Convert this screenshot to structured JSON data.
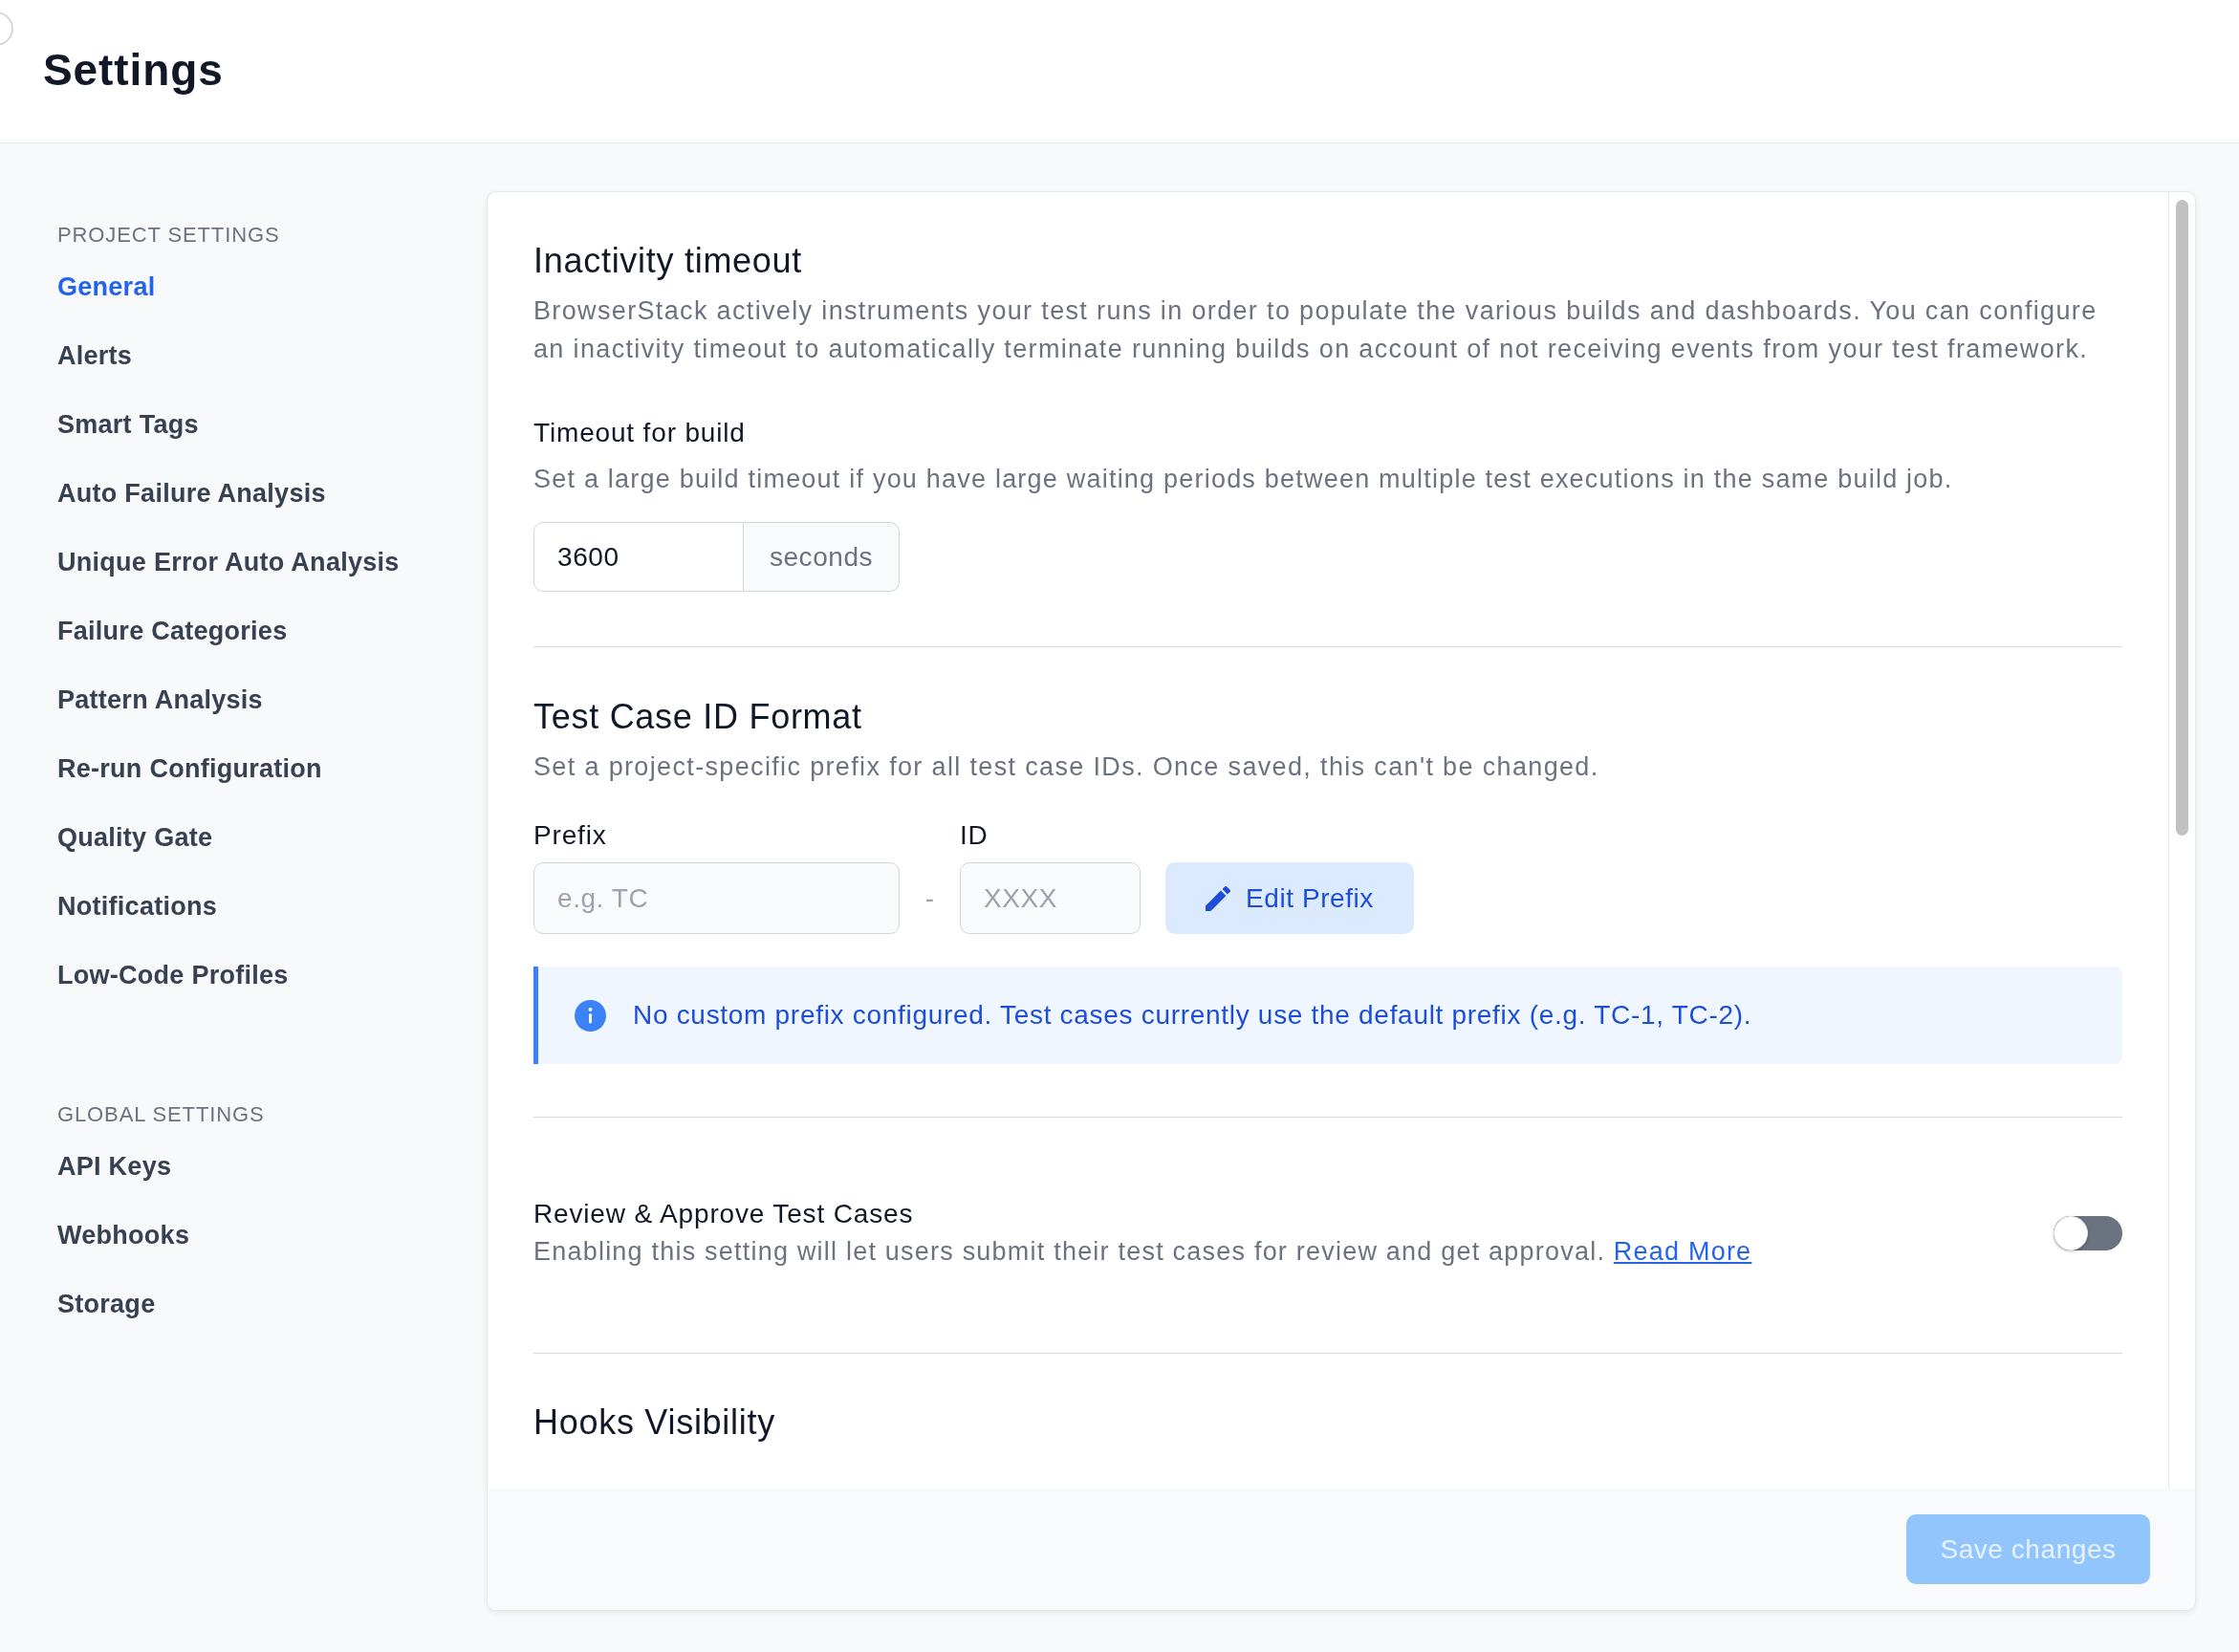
{
  "page": {
    "title": "Settings"
  },
  "sidebar": {
    "groups": [
      {
        "heading": "PROJECT SETTINGS",
        "items": [
          {
            "label": "General",
            "selected": true
          },
          {
            "label": "Alerts",
            "selected": false
          },
          {
            "label": "Smart Tags",
            "selected": false
          },
          {
            "label": "Auto Failure Analysis",
            "selected": false
          },
          {
            "label": "Unique Error Auto Analysis",
            "selected": false
          },
          {
            "label": "Failure Categories",
            "selected": false
          },
          {
            "label": "Pattern Analysis",
            "selected": false
          },
          {
            "label": "Re-run Configuration",
            "selected": false
          },
          {
            "label": "Quality Gate",
            "selected": false
          },
          {
            "label": "Notifications",
            "selected": false
          },
          {
            "label": "Low-Code Profiles",
            "selected": false
          }
        ]
      },
      {
        "heading": "GLOBAL SETTINGS",
        "items": [
          {
            "label": "API Keys",
            "selected": false
          },
          {
            "label": "Webhooks",
            "selected": false
          },
          {
            "label": "Storage",
            "selected": false
          }
        ]
      }
    ]
  },
  "sections": [
    {
      "kind": "timeout",
      "title": "Inactivity timeout",
      "description": "BrowserStack actively instruments your test runs in order to populate the various builds and dashboards. You can configure an inactivity timeout to automatically terminate running builds on account of not receiving events from your test framework.",
      "field": {
        "label": "Timeout for build",
        "hint": "Set a large build timeout if you have large waiting periods between multiple test executions in the same build job.",
        "value": "3600",
        "unit": "seconds"
      }
    },
    {
      "kind": "id_format",
      "title": "Test Case ID Format",
      "description": "Set a project-specific prefix for all test case IDs. Once saved, this can't be changed.",
      "prefix": {
        "label": "Prefix",
        "placeholder": "e.g. TC"
      },
      "separator": "-",
      "id": {
        "label": "ID",
        "placeholder": "XXXX"
      },
      "button": "Edit Prefix",
      "alert": "No custom prefix configured. Test cases currently use the default prefix (e.g. TC-1, TC-2)."
    },
    {
      "kind": "toggle",
      "title": "Review & Approve Test Cases",
      "description": "Enabling this setting will let users submit their test cases for review and get approval.",
      "link": "Read More",
      "on": false
    },
    {
      "kind": "heading",
      "title": "Hooks Visibility"
    }
  ],
  "footer": {
    "save_button": {
      "label": "Save changes",
      "disabled": true
    }
  }
}
